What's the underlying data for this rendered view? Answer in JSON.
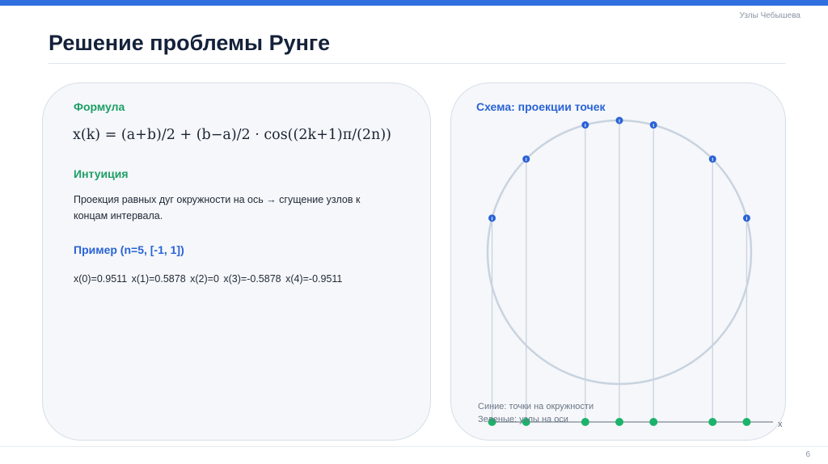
{
  "header": {
    "section_tag": "Узлы Чебышева",
    "title": "Решение проблемы Рунге"
  },
  "left_panel": {
    "formula_heading": "Формула",
    "formula": "x(k) = (a+b)/2 + (b−a)/2 · cos((2k+1)π/(2n))",
    "intuition_heading": "Интуиция",
    "intuition_text": "Проекция равных дуг окружности на ось → сгущение узлов к концам интервала.",
    "example_heading": "Пример (n=5, [-1, 1])",
    "example_values": "x(0)=0.9511  x(1)=0.5878  x(2)=0  x(3)=-0.5878  x(4)=-0.9511"
  },
  "right_panel": {
    "heading": "Схема: проекции точек",
    "axis_label": "x",
    "legend_blue": "Синие: точки на окружности",
    "legend_green": "Зеленые: узлы на оси",
    "projection_angles_deg": [
      15,
      45,
      75,
      90,
      105,
      135,
      165
    ]
  },
  "colors": {
    "accent_blue": "#2a63d6",
    "accent_green": "#1f9f67",
    "circle_stroke": "#c9d3df",
    "point_blue": "#2a63d6",
    "node_green": "#1bb36b"
  },
  "footer": {
    "page_number": "6"
  }
}
